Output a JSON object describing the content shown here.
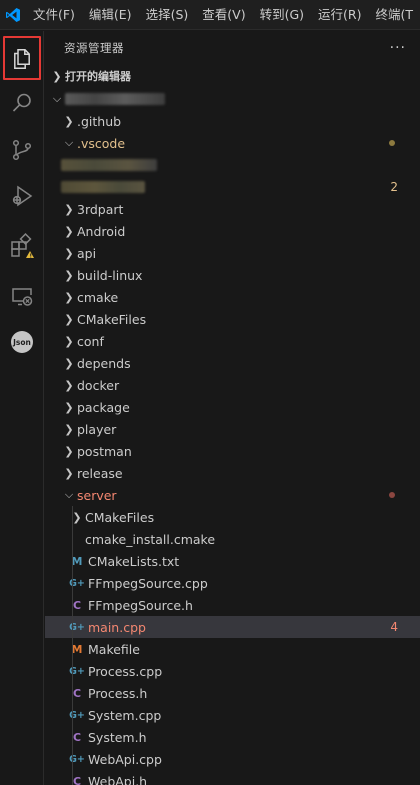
{
  "menu": [
    "文件(F)",
    "编辑(E)",
    "选择(S)",
    "查看(V)",
    "转到(G)",
    "运行(R)",
    "终端(T"
  ],
  "activity": [
    {
      "name": "explorer-icon"
    },
    {
      "name": "search-icon"
    },
    {
      "name": "source-control-icon"
    },
    {
      "name": "run-debug-icon"
    },
    {
      "name": "extensions-icon"
    },
    {
      "name": "remote-explorer-icon"
    },
    {
      "name": "json-icon",
      "text": "Json"
    }
  ],
  "sidebar": {
    "title": "资源管理器",
    "more": "···",
    "open_editors": "打开的编辑器"
  },
  "tree": {
    "github": ".github",
    "vscode": ".vscode",
    "vscode_badge": "2",
    "folders": [
      "3rdpart",
      "Android",
      "api",
      "build-linux",
      "cmake",
      "CMakeFiles",
      "conf",
      "depends",
      "docker",
      "package",
      "player",
      "postman",
      "release"
    ],
    "server": "server",
    "server_children": [
      {
        "label": "CMakeFiles",
        "kind": "folder"
      },
      {
        "label": "cmake_install.cmake",
        "kind": "file-plain"
      },
      {
        "label": "CMakeLists.txt",
        "kind": "cmake",
        "icon": "M"
      },
      {
        "label": "FFmpegSource.cpp",
        "kind": "cpp",
        "icon": "G+"
      },
      {
        "label": "FFmpegSource.h",
        "kind": "h",
        "icon": "C"
      },
      {
        "label": "main.cpp",
        "kind": "cpp",
        "icon": "G+",
        "selected": true,
        "badge": "4"
      },
      {
        "label": "Makefile",
        "kind": "make",
        "icon": "M"
      },
      {
        "label": "Process.cpp",
        "kind": "cpp",
        "icon": "G+"
      },
      {
        "label": "Process.h",
        "kind": "h",
        "icon": "C"
      },
      {
        "label": "System.cpp",
        "kind": "cpp",
        "icon": "G+"
      },
      {
        "label": "System.h",
        "kind": "h",
        "icon": "C"
      },
      {
        "label": "WebApi.cpp",
        "kind": "cpp",
        "icon": "G+"
      },
      {
        "label": "WebApi.h",
        "kind": "h",
        "icon": "C"
      }
    ]
  },
  "colors": {
    "accent_blue": "#0098ff",
    "modified": "#e2c08d",
    "error": "#f48771",
    "cpp_icon": "#519aba",
    "h_icon": "#a074c4",
    "cmake_icon": "#519aba",
    "make_icon": "#e37933"
  }
}
